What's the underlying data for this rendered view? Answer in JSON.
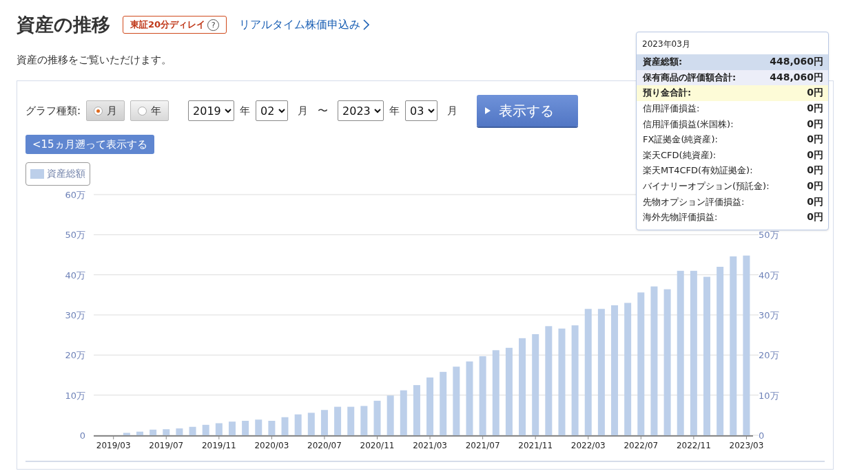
{
  "header": {
    "title": "資産の推移",
    "badge": "東証20分ディレイ",
    "help_icon_char": "?",
    "link": "リアルタイム株価申込み"
  },
  "description": "資産の推移をご覧いただけます。",
  "controls": {
    "graph_type_label": "グラフ種類:",
    "graph_types": [
      {
        "label": "月",
        "selected": true
      },
      {
        "label": "年",
        "selected": false
      }
    ],
    "start_year": "2019",
    "year_unit_1": "年",
    "start_month": "02",
    "month_unit_1": "月",
    "tilde": "〜",
    "end_year": "2023",
    "year_unit_2": "年",
    "end_month": "03",
    "month_unit_2": "月",
    "show_button": "表示する",
    "back_button": "<15ヵ月遡って表示する"
  },
  "chart": {
    "right_axis_labels": [
      "50万",
      "40万",
      "30万",
      "20万",
      "10万",
      "0"
    ],
    "chart_data": {
      "type": "bar",
      "grid": true,
      "categories": [
        null,
        "2019/03",
        null,
        null,
        null,
        "2019/07",
        null,
        null,
        null,
        "2019/11",
        null,
        null,
        null,
        "2020/03",
        null,
        null,
        null,
        "2020/07",
        null,
        null,
        null,
        "2020/11",
        null,
        null,
        null,
        "2021/03",
        null,
        null,
        null,
        "2021/07",
        null,
        null,
        null,
        "2021/11",
        null,
        null,
        null,
        "2022/03",
        null,
        null,
        null,
        "2022/07",
        null,
        null,
        null,
        "2022/11",
        null,
        null,
        null,
        "2023/03"
      ],
      "series": [
        {
          "name": "資産総額",
          "color": "#bccfea",
          "values": [
            0,
            0,
            0.6,
            0.9,
            1.4,
            1.5,
            1.7,
            2.1,
            2.6,
            3.0,
            3.4,
            3.6,
            3.9,
            3.6,
            4.5,
            5.2,
            5.6,
            6.3,
            7.1,
            7.1,
            7.3,
            8.6,
            9.9,
            11.2,
            12.5,
            14.4,
            15.8,
            17.1,
            18.4,
            19.7,
            21.2,
            21.8,
            24.2,
            25.2,
            27.2,
            26.6,
            27.4,
            31.5,
            31.5,
            32.4,
            33.0,
            35.6,
            37.1,
            36.4,
            41.0,
            41.0,
            39.5,
            42.0,
            44.6,
            44.8
          ]
        }
      ],
      "ylim": [
        0,
        60
      ],
      "yticks": [
        {
          "value": 0,
          "label": "0"
        },
        {
          "value": 10,
          "label": "10万"
        },
        {
          "value": 20,
          "label": "20万"
        },
        {
          "value": 30,
          "label": "30万"
        },
        {
          "value": 40,
          "label": "40万"
        },
        {
          "value": 50,
          "label": "50万"
        },
        {
          "value": 60,
          "label": "60万"
        }
      ]
    }
  },
  "tooltip": {
    "title": "2023年03月",
    "rows": [
      {
        "label": "資産総額:",
        "value": "448,060円",
        "kind": "total"
      },
      {
        "label": "保有商品の評価額合計:",
        "value": "448,060円",
        "kind": "holdings"
      },
      {
        "label": "預り金合計:",
        "value": "0円",
        "kind": "deposit"
      },
      {
        "label": "信用評価損益:",
        "value": "0円",
        "kind": "plain"
      },
      {
        "label": "信用評価損益(米国株):",
        "value": "0円",
        "kind": "plain"
      },
      {
        "label": "FX証拠金(純資産):",
        "value": "0円",
        "kind": "plain"
      },
      {
        "label": "楽天CFD(純資産):",
        "value": "0円",
        "kind": "plain"
      },
      {
        "label": "楽天MT4CFD(有効証拠金):",
        "value": "0円",
        "kind": "plain"
      },
      {
        "label": "バイナリーオプション(預託金):",
        "value": "0円",
        "kind": "plain"
      },
      {
        "label": "先物オプション評価損益:",
        "value": "0円",
        "kind": "plain"
      },
      {
        "label": "海外先物評価損益:",
        "value": "0円",
        "kind": "plain"
      }
    ]
  }
}
